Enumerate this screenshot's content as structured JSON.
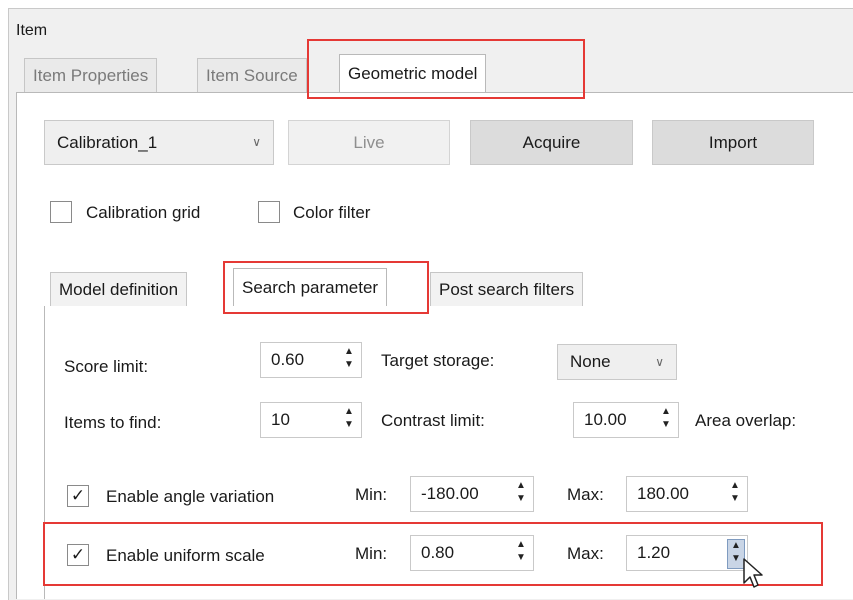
{
  "window": {
    "title": "Item"
  },
  "top_tabs": [
    "Item Properties",
    "Item Source",
    "Geometric model"
  ],
  "toolbar": {
    "calibration_value": "Calibration_1",
    "live_label": "Live",
    "acquire_label": "Acquire",
    "import_label": "Import"
  },
  "options": {
    "calibration_grid_label": "Calibration grid",
    "color_filter_label": "Color filter"
  },
  "inner_tabs": [
    "Model definition",
    "Search parameter",
    "Post search filters"
  ],
  "params": {
    "score_limit_label": "Score limit:",
    "score_limit_value": "0.60",
    "target_storage_label": "Target storage:",
    "target_storage_value": "None",
    "items_to_find_label": "Items to find:",
    "items_to_find_value": "10",
    "contrast_limit_label": "Contrast limit:",
    "contrast_limit_value": "10.00",
    "area_overlap_label": "Area overlap:"
  },
  "angle": {
    "label": "Enable angle variation",
    "min_label": "Min:",
    "min_value": "-180.00",
    "max_label": "Max:",
    "max_value": "180.00",
    "checked": "✓"
  },
  "scale": {
    "label": "Enable uniform scale",
    "min_label": "Min:",
    "min_value": "0.80",
    "max_label": "Max:",
    "max_value": "1.20",
    "checked": "✓"
  },
  "icons": {
    "dropdown": "chevron-down-icon",
    "spin": "spinner-arrows-icon",
    "cursor": "mouse-pointer-icon"
  },
  "colors": {
    "highlight": "#e53935"
  }
}
